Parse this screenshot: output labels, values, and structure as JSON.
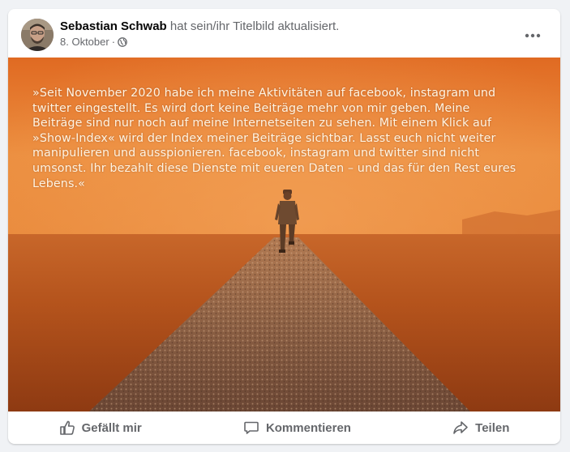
{
  "post": {
    "author": "Sebastian Schwab",
    "action_text": " hat sein/ihr Titelbild aktualisiert.",
    "date": "8. Oktober",
    "separator": "·",
    "audience_icon": "globe-icon",
    "more_icon": "more-options-icon"
  },
  "photo": {
    "overlay_text": "»Seit November 2020 habe ich meine Aktivitäten auf facebook, instagram und twitter eingestellt. Es wird dort keine Beiträge mehr von mir geben. Meine Beiträge sind nur noch auf meine Internetseiten zu sehen. Mit einem Klick auf »Show-Index« wird der Index meiner Beiträge sichtbar. Lasst euch nicht weiter manipulieren und ausspionieren. facebook, instagram und twitter sind nicht umsonst. Ihr bezahlt diese Dienste mit eueren Daten – und das für den Rest eures Lebens.«"
  },
  "actions": {
    "like": {
      "label": "Gefällt mir",
      "icon": "thumbs-up-icon"
    },
    "comment": {
      "label": "Kommentieren",
      "icon": "comment-icon"
    },
    "share": {
      "label": "Teilen",
      "icon": "share-icon"
    }
  },
  "colors": {
    "background": "#f0f2f5",
    "card": "#ffffff",
    "text_primary": "#050505",
    "text_secondary": "#65676b",
    "sky": "#e07a2e",
    "ground": "#b4531c"
  }
}
